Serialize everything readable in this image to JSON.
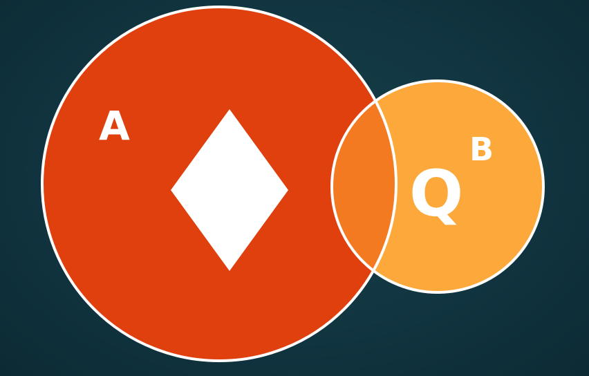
{
  "colors": {
    "background": "#113541",
    "set_a": "#e03f0e",
    "set_b": "#fca83a",
    "intersection": "#f47a22",
    "outline": "#ffffff",
    "symbol": "#ffffff"
  },
  "set_a": {
    "label": "A",
    "symbol": "diamond-icon"
  },
  "set_b": {
    "label": "B",
    "content": "Q"
  }
}
